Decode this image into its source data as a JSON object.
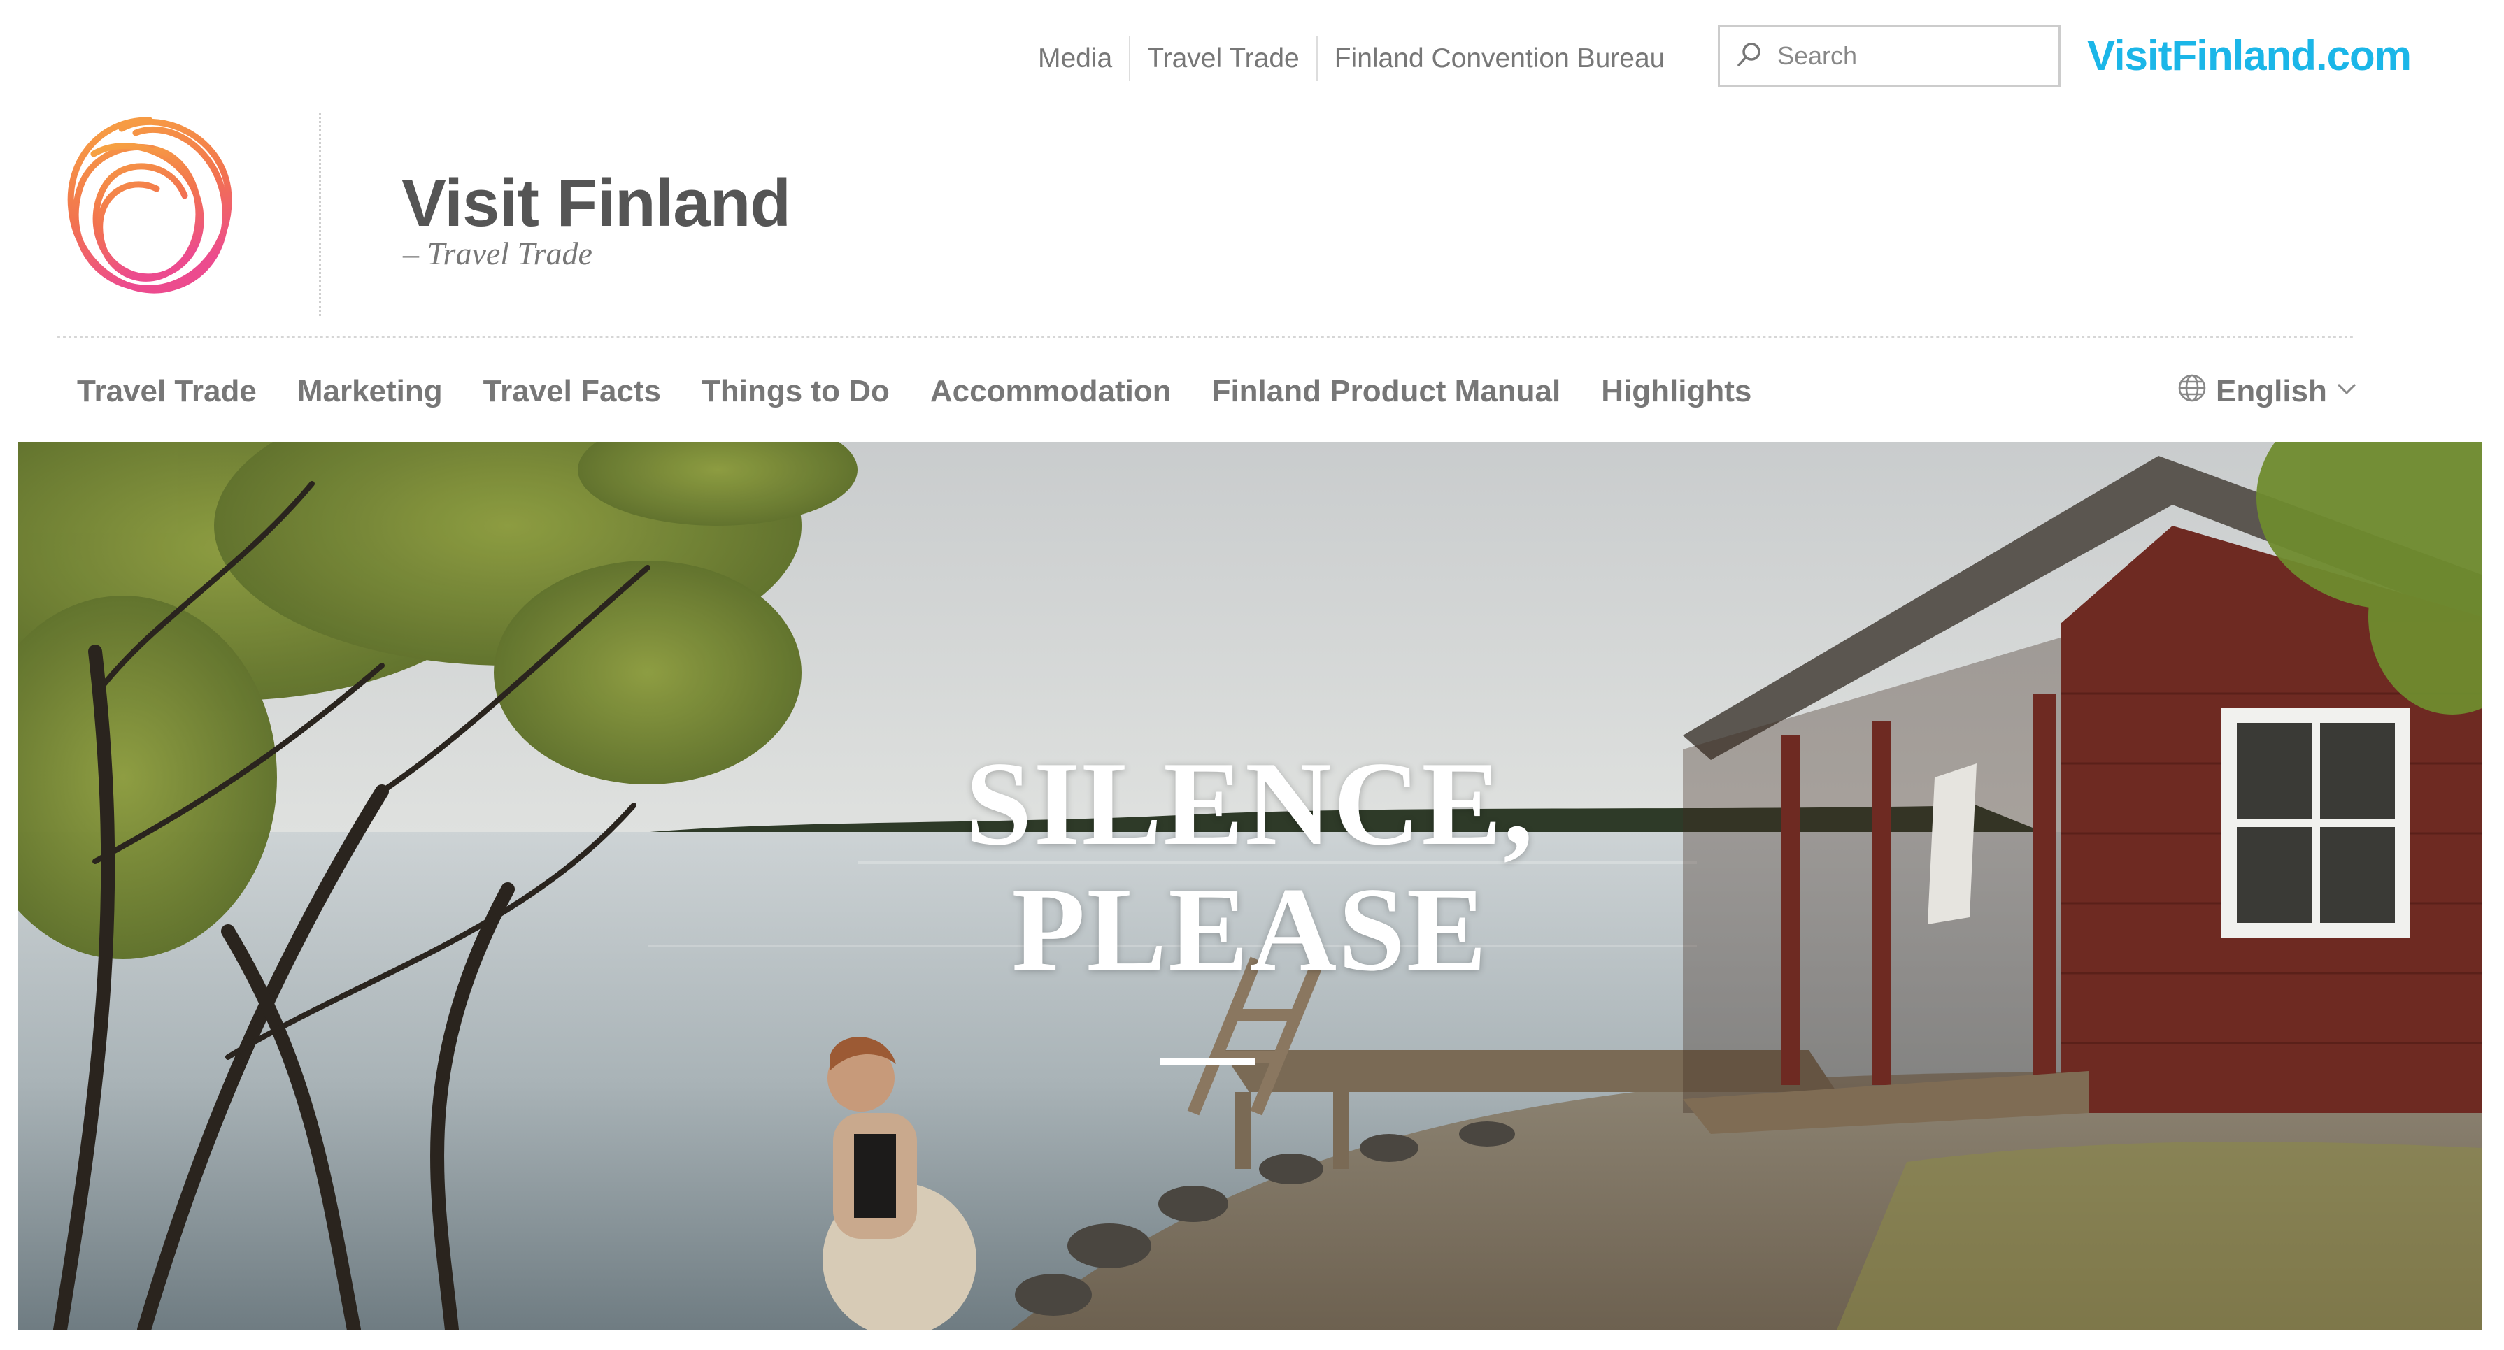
{
  "utility_nav": {
    "links": [
      "Media",
      "Travel Trade",
      "Finland Convention Bureau"
    ]
  },
  "search": {
    "placeholder": "Search"
  },
  "brand_link": "VisitFinland.com",
  "site": {
    "title": "Visit Finland",
    "subtitle": "– Travel Trade"
  },
  "main_nav": {
    "items": [
      "Travel Trade",
      "Marketing",
      "Travel Facts",
      "Things to Do",
      "Accommodation",
      "Finland Product Manual",
      "Highlights"
    ]
  },
  "language": {
    "selected": "English"
  },
  "hero": {
    "headline_line1": "SILENCE,",
    "headline_line2": "PLEASE"
  },
  "colors": {
    "brand_link": "#1bb6e8",
    "logo_gradient": [
      "#f7a541",
      "#ef4f8a"
    ],
    "cabin_red": "#6e2a22"
  },
  "icons": {
    "search": "search-icon",
    "language": "globe-icon",
    "dropdown": "chevron-down-icon",
    "logo": "visit-finland-logo"
  }
}
